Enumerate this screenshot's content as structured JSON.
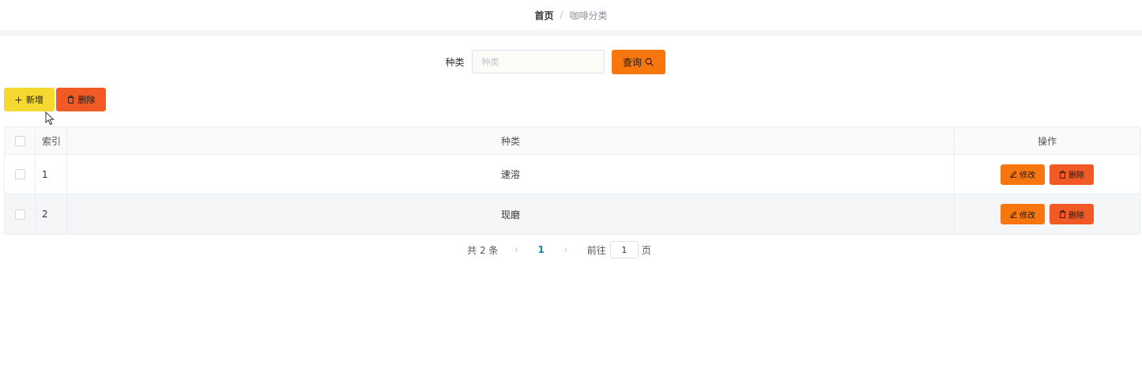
{
  "breadcrumb": {
    "home": "首页",
    "separator": "/",
    "current": "咖啡分类"
  },
  "search": {
    "label": "种类",
    "placeholder": "种类",
    "value": "",
    "button_label": "查询",
    "button_icon": "search-icon"
  },
  "toolbar": {
    "add_label": "新增",
    "add_icon": "plus-icon",
    "delete_label": "删除",
    "delete_icon": "trash-icon"
  },
  "table": {
    "headers": {
      "index": "索引",
      "type": "种类",
      "ops": "操作"
    },
    "rows": [
      {
        "index": "1",
        "type": "速溶",
        "edit_label": "修改",
        "delete_label": "删除"
      },
      {
        "index": "2",
        "type": "现磨",
        "edit_label": "修改",
        "delete_label": "删除"
      }
    ]
  },
  "pagination": {
    "total": "共 2 条",
    "current_page": "1",
    "goto_label": "前往",
    "goto_value": "1",
    "unit": "页"
  },
  "colors": {
    "primary_orange": "#f7760d",
    "danger": "#f15a24",
    "add_yellow": "#f6d930",
    "active_page": "#0d8f95"
  }
}
